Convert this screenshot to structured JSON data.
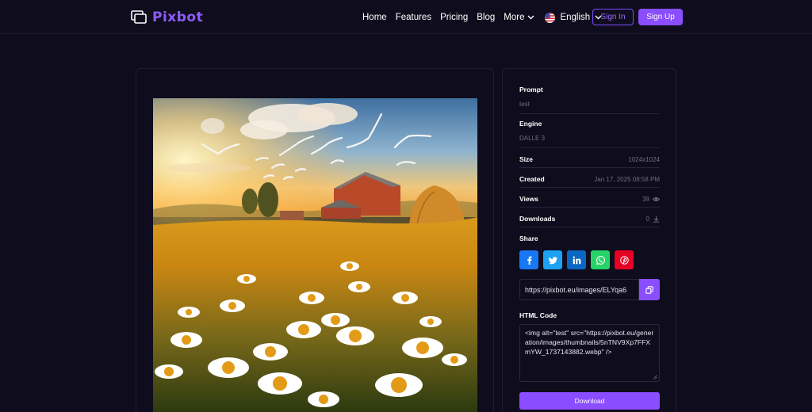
{
  "brand": {
    "name": "Pixbot",
    "color": "#8f5cff"
  },
  "nav": {
    "links": [
      "Home",
      "Features",
      "Pricing",
      "Blog"
    ],
    "more_label": "More",
    "language_label": "English",
    "signin_label": "Sign In",
    "signup_label": "Sign Up"
  },
  "image": {
    "alt": "test"
  },
  "details": {
    "prompt": {
      "label": "Prompt",
      "value": "test"
    },
    "engine": {
      "label": "Engine",
      "value": "DALLE 3"
    },
    "size": {
      "label": "Size",
      "value": "1024x1024"
    },
    "created": {
      "label": "Created",
      "value": "Jan 17, 2025 08:58 PM"
    },
    "views": {
      "label": "Views",
      "value": "39"
    },
    "downloads": {
      "label": "Downloads",
      "value": "0"
    }
  },
  "share": {
    "label": "Share",
    "link_value": "https://pixbot.eu/images/ELYqa6",
    "colors": {
      "facebook": "#1877f2",
      "twitter": "#1da1f2",
      "linkedin": "#0a66c2",
      "whatsapp": "#25d366",
      "pinterest": "#e60023"
    }
  },
  "html_code": {
    "label": "HTML Code",
    "value": "<img alt=\"test\" src=\"https://pixbot.eu/generation/images/thumbnails/5nTNV9Xp7FFXmYW_1737143882.webp\" />"
  },
  "download_label": "Download",
  "accent": "#8a4dff"
}
